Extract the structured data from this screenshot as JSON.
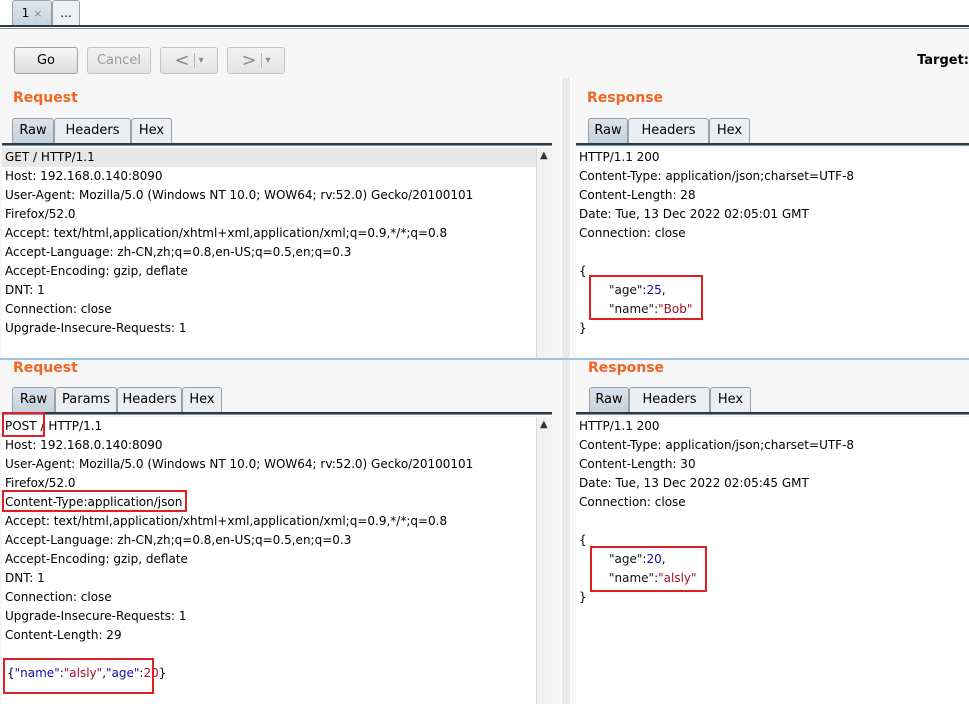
{
  "tabs": [
    {
      "label": "1",
      "close": "×"
    },
    {
      "label": "..."
    }
  ],
  "toolbar": {
    "go": "Go",
    "cancel": "Cancel",
    "back": "<",
    "forward": ">",
    "dropdown": "▾",
    "target": "Target:"
  },
  "top": {
    "request": {
      "title": "Request",
      "tabs": [
        "Raw",
        "Headers",
        "Hex"
      ],
      "lines": [
        "GET / HTTP/1.1",
        "Host: 192.168.0.140:8090",
        "User-Agent: Mozilla/5.0 (Windows NT 10.0; WOW64; rv:52.0) Gecko/20100101",
        "Firefox/52.0",
        "Accept: text/html,application/xhtml+xml,application/xml;q=0.9,*/*;q=0.8",
        "Accept-Language: zh-CN,zh;q=0.8,en-US;q=0.5,en;q=0.3",
        "Accept-Encoding: gzip, deflate",
        "DNT: 1",
        "Connection: close",
        "Upgrade-Insecure-Requests: 1"
      ]
    },
    "response": {
      "title": "Response",
      "tabs": [
        "Raw",
        "Headers",
        "Hex"
      ],
      "lines": [
        "HTTP/1.1 200",
        "Content-Type: application/json;charset=UTF-8",
        "Content-Length: 28",
        "Date: Tue, 13 Dec 2022 02:05:01 GMT",
        "Connection: close"
      ],
      "open": "{",
      "age_key": "\"age\"",
      "age_val": "25",
      "name_key": "\"name\"",
      "name_val": "\"Bob\"",
      "close": "}"
    }
  },
  "bottom": {
    "request": {
      "title": "Request",
      "tabs": [
        "Raw",
        "Params",
        "Headers",
        "Hex"
      ],
      "method": "POST",
      "first_rest": " / HTTP/1.1",
      "lines_a": [
        "Host: 192.168.0.140:8090",
        "User-Agent: Mozilla/5.0 (Windows NT 10.0; WOW64; rv:52.0) Gecko/20100101",
        "Firefox/52.0"
      ],
      "content_type": "Content-Type:application/json",
      "lines_b": [
        "Accept: text/html,application/xhtml+xml,application/xml;q=0.9,*/*;q=0.8",
        "Accept-Language: zh-CN,zh;q=0.8,en-US;q=0.5,en;q=0.3",
        "Accept-Encoding: gzip, deflate",
        "DNT: 1",
        "Connection: close",
        "Upgrade-Insecure-Requests: 1",
        "Content-Length: 29"
      ],
      "body": {
        "open": "{",
        "name_key": "\"name\"",
        "name_val": "\"alsly\"",
        "age_key": "\"age\"",
        "age_val": "20",
        "close": "}"
      }
    },
    "response": {
      "title": "Response",
      "tabs": [
        "Raw",
        "Headers",
        "Hex"
      ],
      "lines": [
        "HTTP/1.1 200",
        "Content-Type: application/json;charset=UTF-8",
        "Content-Length: 30",
        "Date: Tue, 13 Dec 2022 02:05:45 GMT",
        "Connection: close"
      ],
      "open": "{",
      "age_key": "\"age\"",
      "age_val": "20",
      "name_key": "\"name\"",
      "name_val": "\"alsly\"",
      "close": "}"
    }
  },
  "colors": {
    "title": "#f26522",
    "highlight_box": "#e02020"
  }
}
